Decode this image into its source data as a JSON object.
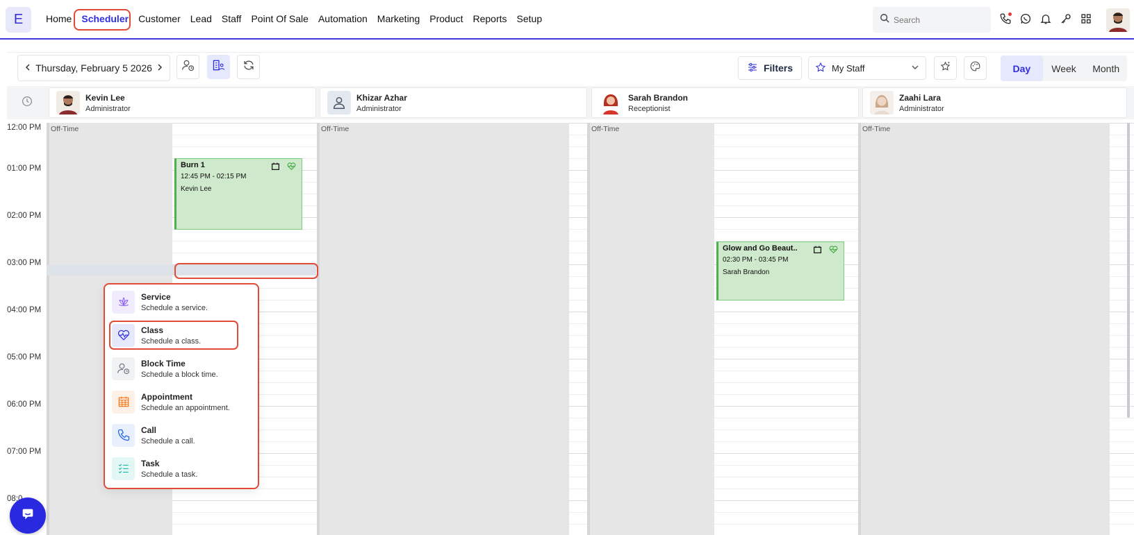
{
  "app": {
    "logo_letter": "E"
  },
  "nav": {
    "items": [
      "Home",
      "Scheduler",
      "Customer",
      "Lead",
      "Staff",
      "Point Of Sale",
      "Automation",
      "Marketing",
      "Product",
      "Reports",
      "Setup"
    ],
    "active": "Scheduler"
  },
  "search": {
    "placeholder": "Search"
  },
  "toolbar": {
    "date": "Thursday, February 5 2026",
    "filters_label": "Filters",
    "staff_select": "My Staff",
    "views": [
      "Day",
      "Week",
      "Month"
    ],
    "active_view": "Day"
  },
  "staff": [
    {
      "name": "Kevin Lee",
      "role": "Administrator"
    },
    {
      "name": "Khizar Azhar",
      "role": "Administrator"
    },
    {
      "name": "Sarah Brandon",
      "role": "Receptionist"
    },
    {
      "name": "Zaahi Lara",
      "role": "Administrator"
    }
  ],
  "times": [
    "12:00 PM",
    "01:00 PM",
    "02:00 PM",
    "03:00 PM",
    "04:00 PM",
    "05:00 PM",
    "06:00 PM",
    "07:00 PM",
    "08:0"
  ],
  "off_time_label": "Off-Time",
  "events": [
    {
      "title": "Burn 1",
      "time": "12:45 PM - 02:15 PM",
      "staff": "Kevin Lee"
    },
    {
      "title": "Glow and Go Beaut..",
      "time": "02:30 PM - 03:45 PM",
      "staff": "Sarah Brandon"
    }
  ],
  "create_menu": {
    "items": [
      {
        "label": "Service",
        "desc": "Schedule a service.",
        "icon": "lotus-icon",
        "color": "#8b5cf6"
      },
      {
        "label": "Class",
        "desc": "Schedule a class.",
        "icon": "heartbeat-icon",
        "color": "#2f2fe0"
      },
      {
        "label": "Block Time",
        "desc": "Schedule a block time.",
        "icon": "user-clock-icon",
        "color": "#6b7280"
      },
      {
        "label": "Appointment",
        "desc": "Schedule an appointment.",
        "icon": "calendar-grid-icon",
        "color": "#f97316"
      },
      {
        "label": "Call",
        "desc": "Schedule a call.",
        "icon": "phone-icon",
        "color": "#2563eb"
      },
      {
        "label": "Task",
        "desc": "Schedule a task.",
        "icon": "checklist-icon",
        "color": "#14b8a6"
      }
    ]
  },
  "colors": {
    "accent": "#2f2fe0",
    "highlight": "#e04a36",
    "event_bg": "#cfe9cc",
    "event_border": "#4cb24c"
  }
}
